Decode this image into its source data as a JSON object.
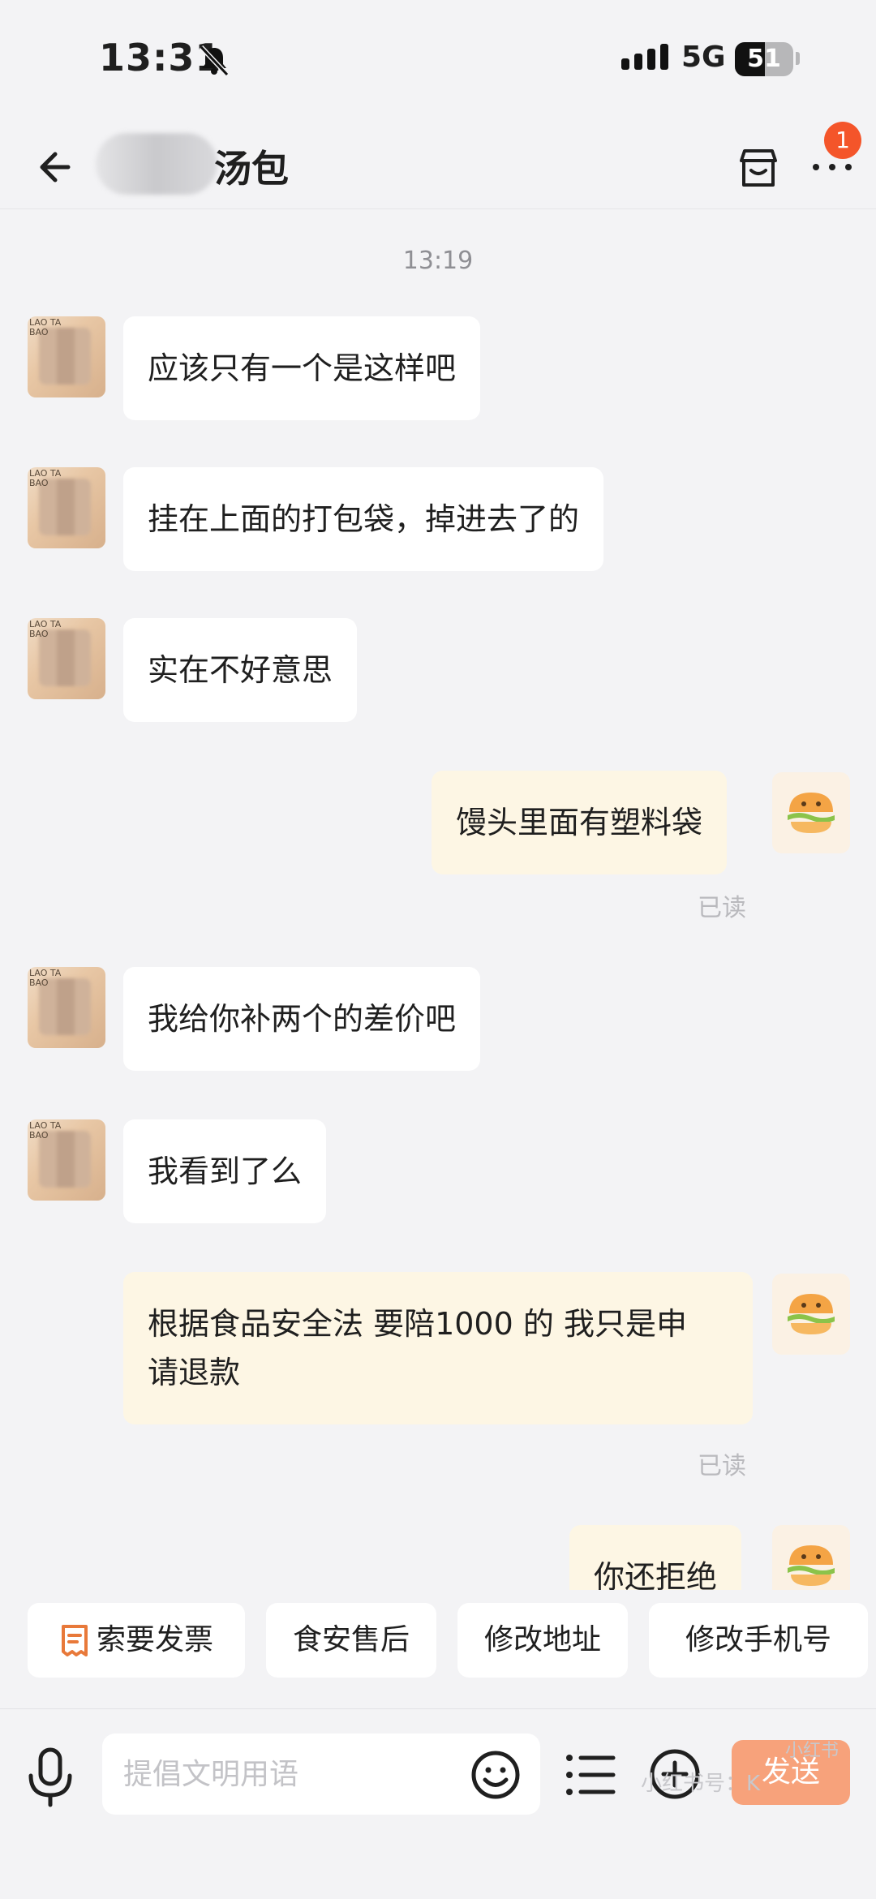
{
  "status_bar": {
    "time": "13:31",
    "network": "5G",
    "battery": "51",
    "battery_level": 0.51
  },
  "header": {
    "title": "汤包",
    "notification_count": "1"
  },
  "timestamp": "13:19",
  "messages": [
    {
      "side": "in",
      "text": "应该只有一个是这样吧"
    },
    {
      "side": "in",
      "text": "挂在上面的打包袋，掉进去了的"
    },
    {
      "side": "in",
      "text": "实在不好意思"
    },
    {
      "side": "out",
      "text": "馒头里面有塑料袋",
      "status": "已读"
    },
    {
      "side": "in",
      "text": "我给你补两个的差价吧"
    },
    {
      "side": "in",
      "text": "我看到了么"
    },
    {
      "side": "out",
      "text_line1": "根据食品安全法 要陪1000 的 我只是申",
      "text_line2": "请退款",
      "status": "已读"
    },
    {
      "side": "out",
      "text": "你还拒绝"
    }
  ],
  "quick_actions": [
    {
      "label": "索要发票",
      "icon": "receipt-icon"
    },
    {
      "label": "食安售后"
    },
    {
      "label": "修改地址"
    },
    {
      "label": "修改手机号"
    }
  ],
  "input": {
    "placeholder": "提倡文明用语",
    "send_label": "发送"
  },
  "colors": {
    "accent": "#f4552a",
    "send_button": "#f7a27b",
    "outgoing_bubble": "#fdf6e4",
    "incoming_bubble": "#ffffff"
  },
  "watermark": "小红书号：K",
  "watermark2": "小红书"
}
